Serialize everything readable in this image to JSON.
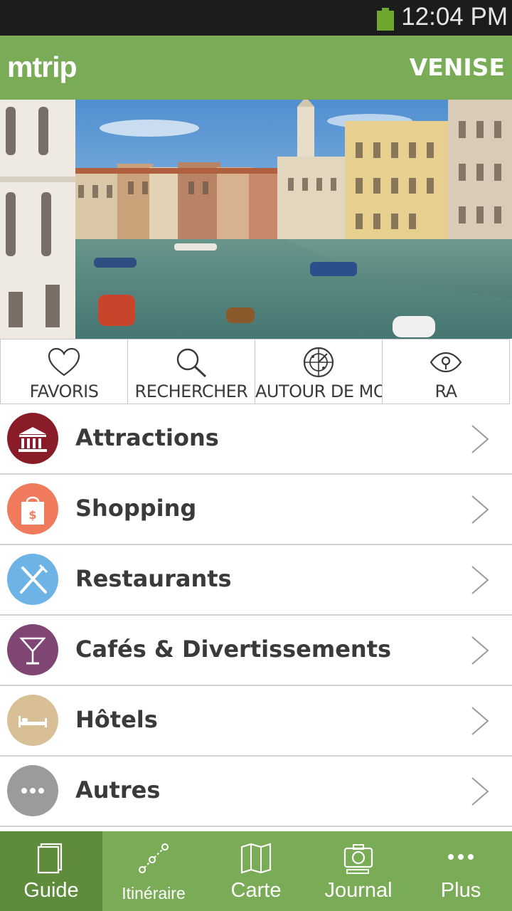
{
  "status_bar": {
    "time": "12:04 PM"
  },
  "app_bar": {
    "logo": "mtrip",
    "city": "VENISE"
  },
  "quick_actions": [
    {
      "label": "FAVORIS",
      "icon": "heart-icon"
    },
    {
      "label": "RECHERCHER",
      "icon": "search-icon"
    },
    {
      "label": "AUTOUR DE MOI",
      "icon": "radar-icon"
    },
    {
      "label": "RA",
      "icon": "eye-icon"
    }
  ],
  "categories": [
    {
      "label": "Attractions",
      "icon": "museum-icon",
      "color": "#8a1c2a"
    },
    {
      "label": "Shopping",
      "icon": "shopping-bag-icon",
      "color": "#ef7b5c"
    },
    {
      "label": "Restaurants",
      "icon": "fork-knife-icon",
      "color": "#6db3e6"
    },
    {
      "label": "Cafés & Divertissements",
      "icon": "cocktail-icon",
      "color": "#7f4674"
    },
    {
      "label": "Hôtels",
      "icon": "bed-icon",
      "color": "#d8bf96"
    },
    {
      "label": "Autres",
      "icon": "more-icon",
      "color": "#9b9b9b"
    }
  ],
  "bottom_nav": [
    {
      "label": "Guide",
      "icon": "book-icon",
      "active": true
    },
    {
      "label": "Itinéraire",
      "icon": "route-icon",
      "active": false
    },
    {
      "label": "Carte",
      "icon": "map-icon",
      "active": false
    },
    {
      "label": "Journal",
      "icon": "camera-icon",
      "active": false
    },
    {
      "label": "Plus",
      "icon": "more-icon",
      "active": false
    }
  ],
  "colors": {
    "brand_green": "#7aab56",
    "active_tab": "#5f8c3c",
    "status_bar": "#1c1c1c",
    "battery": "#6ea62f"
  }
}
